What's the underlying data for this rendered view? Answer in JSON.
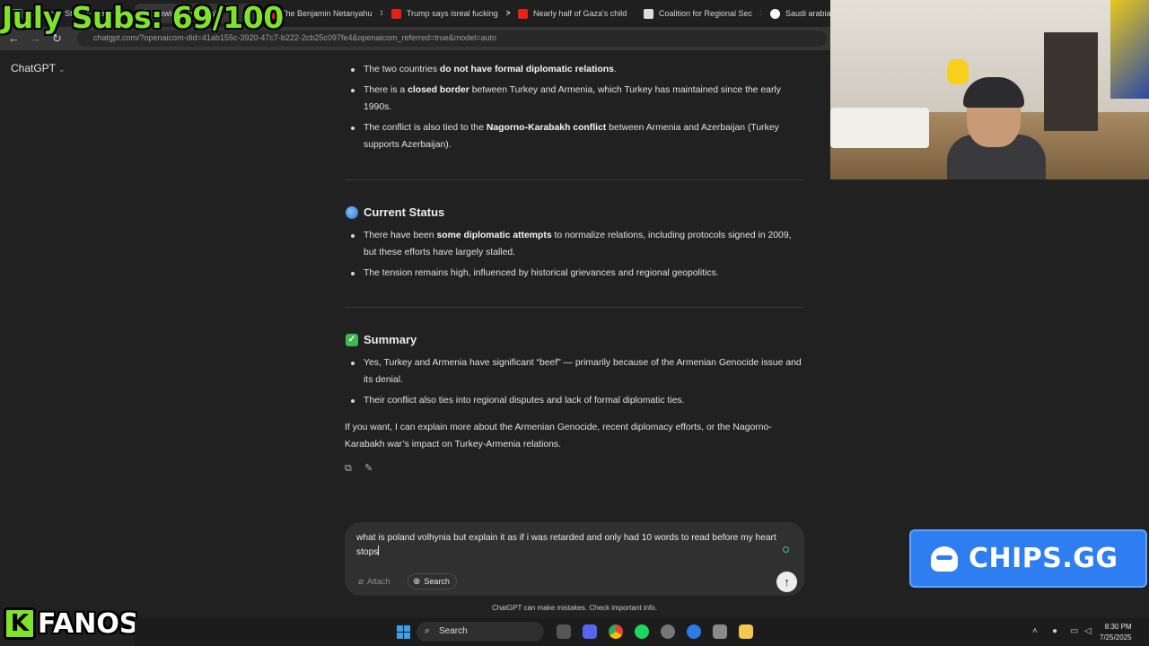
{
  "overlay": {
    "subs_goal": "July Subs: 69/100",
    "sponsor": "CHIPS.GG",
    "streamer_logo": "FANOS",
    "streamer_logo_letter": "K"
  },
  "browser": {
    "tabs": [
      {
        "label": "AdinRoss Stream Watch",
        "icon": "green-logo-icon"
      },
      {
        "label": "Jewish Land Prob",
        "icon": "globe-icon"
      },
      {
        "label": "The Benjamin Netanyahu",
        "icon": "youtube-icon"
      },
      {
        "label": "Trump says isreal fucking",
        "icon": "youtube-icon"
      },
      {
        "label": "Nearly half of Gaza's child",
        "icon": "youtube-icon"
      },
      {
        "label": "Coalition for Regional Sec",
        "icon": "site-icon"
      },
      {
        "label": "Saudi arabia y",
        "icon": "google-icon"
      }
    ],
    "url": "chatgpt.com/?openaicom-did=41ab155c-3920-47c7-b222-2cb25c097fe4&openaicom_referred=true&model=auto"
  },
  "app": {
    "title": "ChatGPT"
  },
  "response": {
    "relations_bullets": [
      {
        "pre": "The two countries ",
        "bold": "do not have formal diplomatic relations",
        "post": "."
      },
      {
        "pre": "There is a ",
        "bold": "closed border",
        "post": " between Turkey and Armenia, which Turkey has maintained since the early 1990s."
      },
      {
        "pre": "The conflict is also tied to the ",
        "bold": "Nagorno-Karabakh conflict",
        "post": " between Armenia and Azerbaijan (Turkey supports Azerbaijan)."
      }
    ],
    "current_status": {
      "heading": "Current Status",
      "bullets": [
        {
          "pre": "There have been ",
          "bold": "some diplomatic attempts",
          "post": " to normalize relations, including protocols signed in 2009, but these efforts have largely stalled."
        },
        {
          "pre": "The tension remains high, influenced by historical grievances and regional geopolitics.",
          "bold": "",
          "post": ""
        }
      ]
    },
    "summary": {
      "heading": "Summary",
      "bullets": [
        {
          "pre": "Yes, Turkey and Armenia have significant “beef” — primarily because of the Armenian Genocide issue and its denial.",
          "bold": "",
          "post": ""
        },
        {
          "pre": "Their conflict also ties into regional disputes and lack of formal diplomatic ties.",
          "bold": "",
          "post": ""
        }
      ]
    },
    "closing": "If you want, I can explain more about the Armenian Genocide, recent diplomacy efforts, or the Nagorno-Karabakh war’s impact on Turkey-Armenia relations."
  },
  "composer": {
    "draft": "what is poland volhynia but explain it as if i was retarded and only had 10 words to read before my heart stops",
    "attach_label": "Attach",
    "search_label": "Search"
  },
  "disclaimer": "ChatGPT can make mistakes. Check important info.",
  "taskbar": {
    "search_label": "Search",
    "time": "8:30 PM",
    "date": "7/25/2025"
  },
  "colors": {
    "subs_text": "#7ee32a",
    "sponsor_bg": "#2f7ef1",
    "page_bg": "#212121",
    "composer_bg": "#303030"
  }
}
